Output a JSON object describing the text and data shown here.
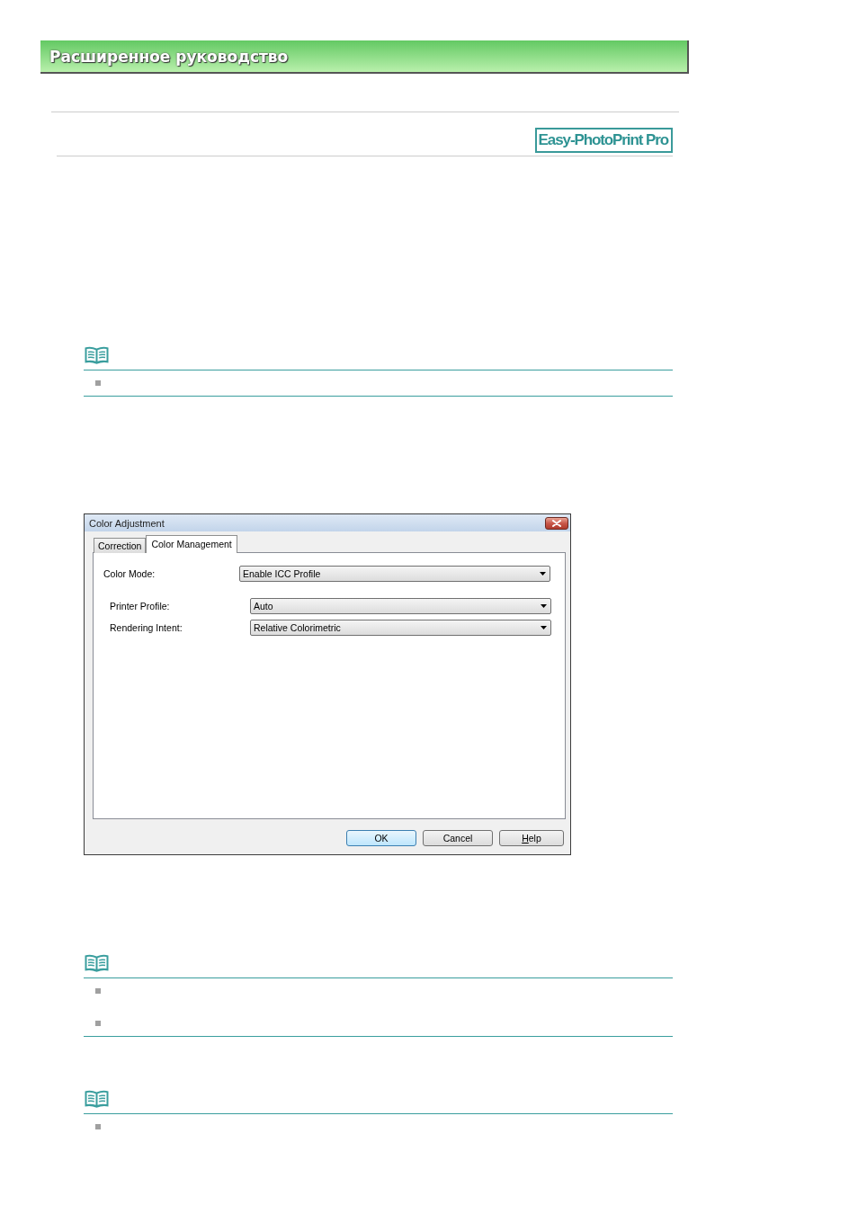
{
  "header": {
    "title": "Расширенное руководство"
  },
  "product_logo": {
    "label": "Easy-PhotoPrint Pro"
  },
  "content": [
    {
      "kind": "note",
      "bottom_rule": true,
      "items": [
        {
          "kind": "bullet"
        }
      ]
    },
    {
      "kind": "dialog",
      "title": "Color Adjustment",
      "tabs": [
        {
          "label": "Correction",
          "selected": false
        },
        {
          "label": "Color Management",
          "selected": true
        }
      ],
      "fields": [
        {
          "label": "Color Mode:",
          "value": "Enable ICC Profile",
          "children": [
            {
              "label": "Printer Profile:",
              "value": "Auto"
            },
            {
              "label": "Rendering Intent:",
              "value": "Relative Colorimetric"
            }
          ]
        }
      ],
      "buttons": [
        {
          "label": "OK",
          "default": true,
          "mnemonic_first": false
        },
        {
          "label": "Cancel",
          "default": false,
          "mnemonic_first": false
        },
        {
          "label": "Help",
          "default": false,
          "mnemonic_first": true
        }
      ]
    },
    {
      "kind": "note",
      "bottom_rule": true,
      "items": [
        {
          "kind": "bullet"
        },
        {
          "kind": "bullet"
        }
      ]
    },
    {
      "kind": "note",
      "bottom_rule": false,
      "items": [
        {
          "kind": "bullet"
        }
      ]
    }
  ]
}
